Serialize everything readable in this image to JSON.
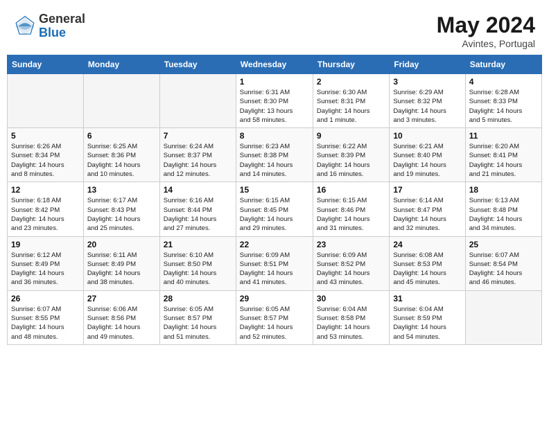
{
  "header": {
    "logo_line1": "General",
    "logo_line2": "Blue",
    "month_title": "May 2024",
    "location": "Avintes, Portugal"
  },
  "weekdays": [
    "Sunday",
    "Monday",
    "Tuesday",
    "Wednesday",
    "Thursday",
    "Friday",
    "Saturday"
  ],
  "weeks": [
    [
      {
        "day": "",
        "info": ""
      },
      {
        "day": "",
        "info": ""
      },
      {
        "day": "",
        "info": ""
      },
      {
        "day": "1",
        "info": "Sunrise: 6:31 AM\nSunset: 8:30 PM\nDaylight: 13 hours\nand 58 minutes."
      },
      {
        "day": "2",
        "info": "Sunrise: 6:30 AM\nSunset: 8:31 PM\nDaylight: 14 hours\nand 1 minute."
      },
      {
        "day": "3",
        "info": "Sunrise: 6:29 AM\nSunset: 8:32 PM\nDaylight: 14 hours\nand 3 minutes."
      },
      {
        "day": "4",
        "info": "Sunrise: 6:28 AM\nSunset: 8:33 PM\nDaylight: 14 hours\nand 5 minutes."
      }
    ],
    [
      {
        "day": "5",
        "info": "Sunrise: 6:26 AM\nSunset: 8:34 PM\nDaylight: 14 hours\nand 8 minutes."
      },
      {
        "day": "6",
        "info": "Sunrise: 6:25 AM\nSunset: 8:36 PM\nDaylight: 14 hours\nand 10 minutes."
      },
      {
        "day": "7",
        "info": "Sunrise: 6:24 AM\nSunset: 8:37 PM\nDaylight: 14 hours\nand 12 minutes."
      },
      {
        "day": "8",
        "info": "Sunrise: 6:23 AM\nSunset: 8:38 PM\nDaylight: 14 hours\nand 14 minutes."
      },
      {
        "day": "9",
        "info": "Sunrise: 6:22 AM\nSunset: 8:39 PM\nDaylight: 14 hours\nand 16 minutes."
      },
      {
        "day": "10",
        "info": "Sunrise: 6:21 AM\nSunset: 8:40 PM\nDaylight: 14 hours\nand 19 minutes."
      },
      {
        "day": "11",
        "info": "Sunrise: 6:20 AM\nSunset: 8:41 PM\nDaylight: 14 hours\nand 21 minutes."
      }
    ],
    [
      {
        "day": "12",
        "info": "Sunrise: 6:18 AM\nSunset: 8:42 PM\nDaylight: 14 hours\nand 23 minutes."
      },
      {
        "day": "13",
        "info": "Sunrise: 6:17 AM\nSunset: 8:43 PM\nDaylight: 14 hours\nand 25 minutes."
      },
      {
        "day": "14",
        "info": "Sunrise: 6:16 AM\nSunset: 8:44 PM\nDaylight: 14 hours\nand 27 minutes."
      },
      {
        "day": "15",
        "info": "Sunrise: 6:15 AM\nSunset: 8:45 PM\nDaylight: 14 hours\nand 29 minutes."
      },
      {
        "day": "16",
        "info": "Sunrise: 6:15 AM\nSunset: 8:46 PM\nDaylight: 14 hours\nand 31 minutes."
      },
      {
        "day": "17",
        "info": "Sunrise: 6:14 AM\nSunset: 8:47 PM\nDaylight: 14 hours\nand 32 minutes."
      },
      {
        "day": "18",
        "info": "Sunrise: 6:13 AM\nSunset: 8:48 PM\nDaylight: 14 hours\nand 34 minutes."
      }
    ],
    [
      {
        "day": "19",
        "info": "Sunrise: 6:12 AM\nSunset: 8:49 PM\nDaylight: 14 hours\nand 36 minutes."
      },
      {
        "day": "20",
        "info": "Sunrise: 6:11 AM\nSunset: 8:49 PM\nDaylight: 14 hours\nand 38 minutes."
      },
      {
        "day": "21",
        "info": "Sunrise: 6:10 AM\nSunset: 8:50 PM\nDaylight: 14 hours\nand 40 minutes."
      },
      {
        "day": "22",
        "info": "Sunrise: 6:09 AM\nSunset: 8:51 PM\nDaylight: 14 hours\nand 41 minutes."
      },
      {
        "day": "23",
        "info": "Sunrise: 6:09 AM\nSunset: 8:52 PM\nDaylight: 14 hours\nand 43 minutes."
      },
      {
        "day": "24",
        "info": "Sunrise: 6:08 AM\nSunset: 8:53 PM\nDaylight: 14 hours\nand 45 minutes."
      },
      {
        "day": "25",
        "info": "Sunrise: 6:07 AM\nSunset: 8:54 PM\nDaylight: 14 hours\nand 46 minutes."
      }
    ],
    [
      {
        "day": "26",
        "info": "Sunrise: 6:07 AM\nSunset: 8:55 PM\nDaylight: 14 hours\nand 48 minutes."
      },
      {
        "day": "27",
        "info": "Sunrise: 6:06 AM\nSunset: 8:56 PM\nDaylight: 14 hours\nand 49 minutes."
      },
      {
        "day": "28",
        "info": "Sunrise: 6:05 AM\nSunset: 8:57 PM\nDaylight: 14 hours\nand 51 minutes."
      },
      {
        "day": "29",
        "info": "Sunrise: 6:05 AM\nSunset: 8:57 PM\nDaylight: 14 hours\nand 52 minutes."
      },
      {
        "day": "30",
        "info": "Sunrise: 6:04 AM\nSunset: 8:58 PM\nDaylight: 14 hours\nand 53 minutes."
      },
      {
        "day": "31",
        "info": "Sunrise: 6:04 AM\nSunset: 8:59 PM\nDaylight: 14 hours\nand 54 minutes."
      },
      {
        "day": "",
        "info": ""
      }
    ]
  ]
}
